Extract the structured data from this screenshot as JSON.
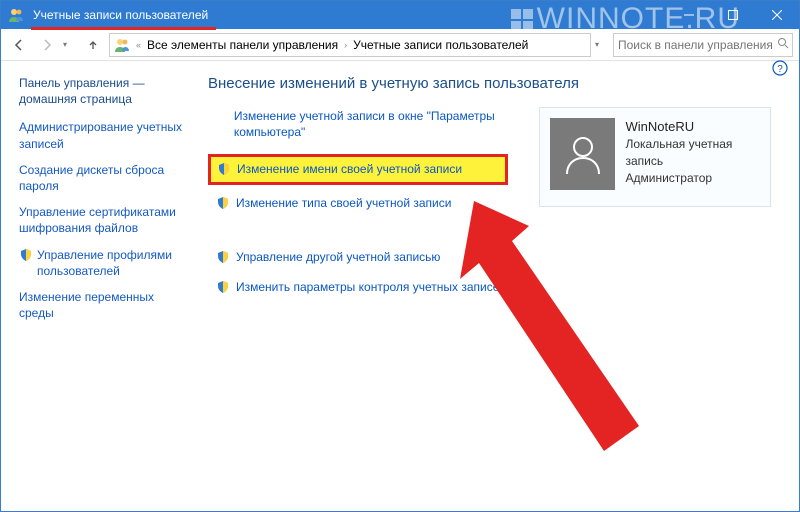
{
  "titlebar": {
    "title": "Учетные записи пользователей"
  },
  "watermark": "WINNOTE.RU",
  "nav": {
    "crumb_root": "Все элементы панели управления",
    "crumb_current": "Учетные записи пользователей",
    "search_placeholder": "Поиск в панели управления"
  },
  "sidebar": {
    "heading": "Панель управления — домашняя страница",
    "links": [
      "Администрирование учетных записей",
      "Создание дискеты сброса пароля",
      "Управление сертификатами шифрования файлов",
      "Управление профилями пользователей",
      "Изменение переменных среды"
    ]
  },
  "main": {
    "title": "Внесение изменений в учетную запись пользователя",
    "link_change_in_settings": "Изменение учетной записи в окне \"Параметры компьютера\"",
    "link_rename": "Изменение имени своей учетной записи",
    "link_change_type": "Изменение типа своей учетной записи",
    "link_manage_other": "Управление другой учетной записью",
    "link_uac": "Изменить параметры контроля учетных записей"
  },
  "user": {
    "name": "WinNoteRU",
    "type": "Локальная учетная запись",
    "role": "Администратор"
  }
}
